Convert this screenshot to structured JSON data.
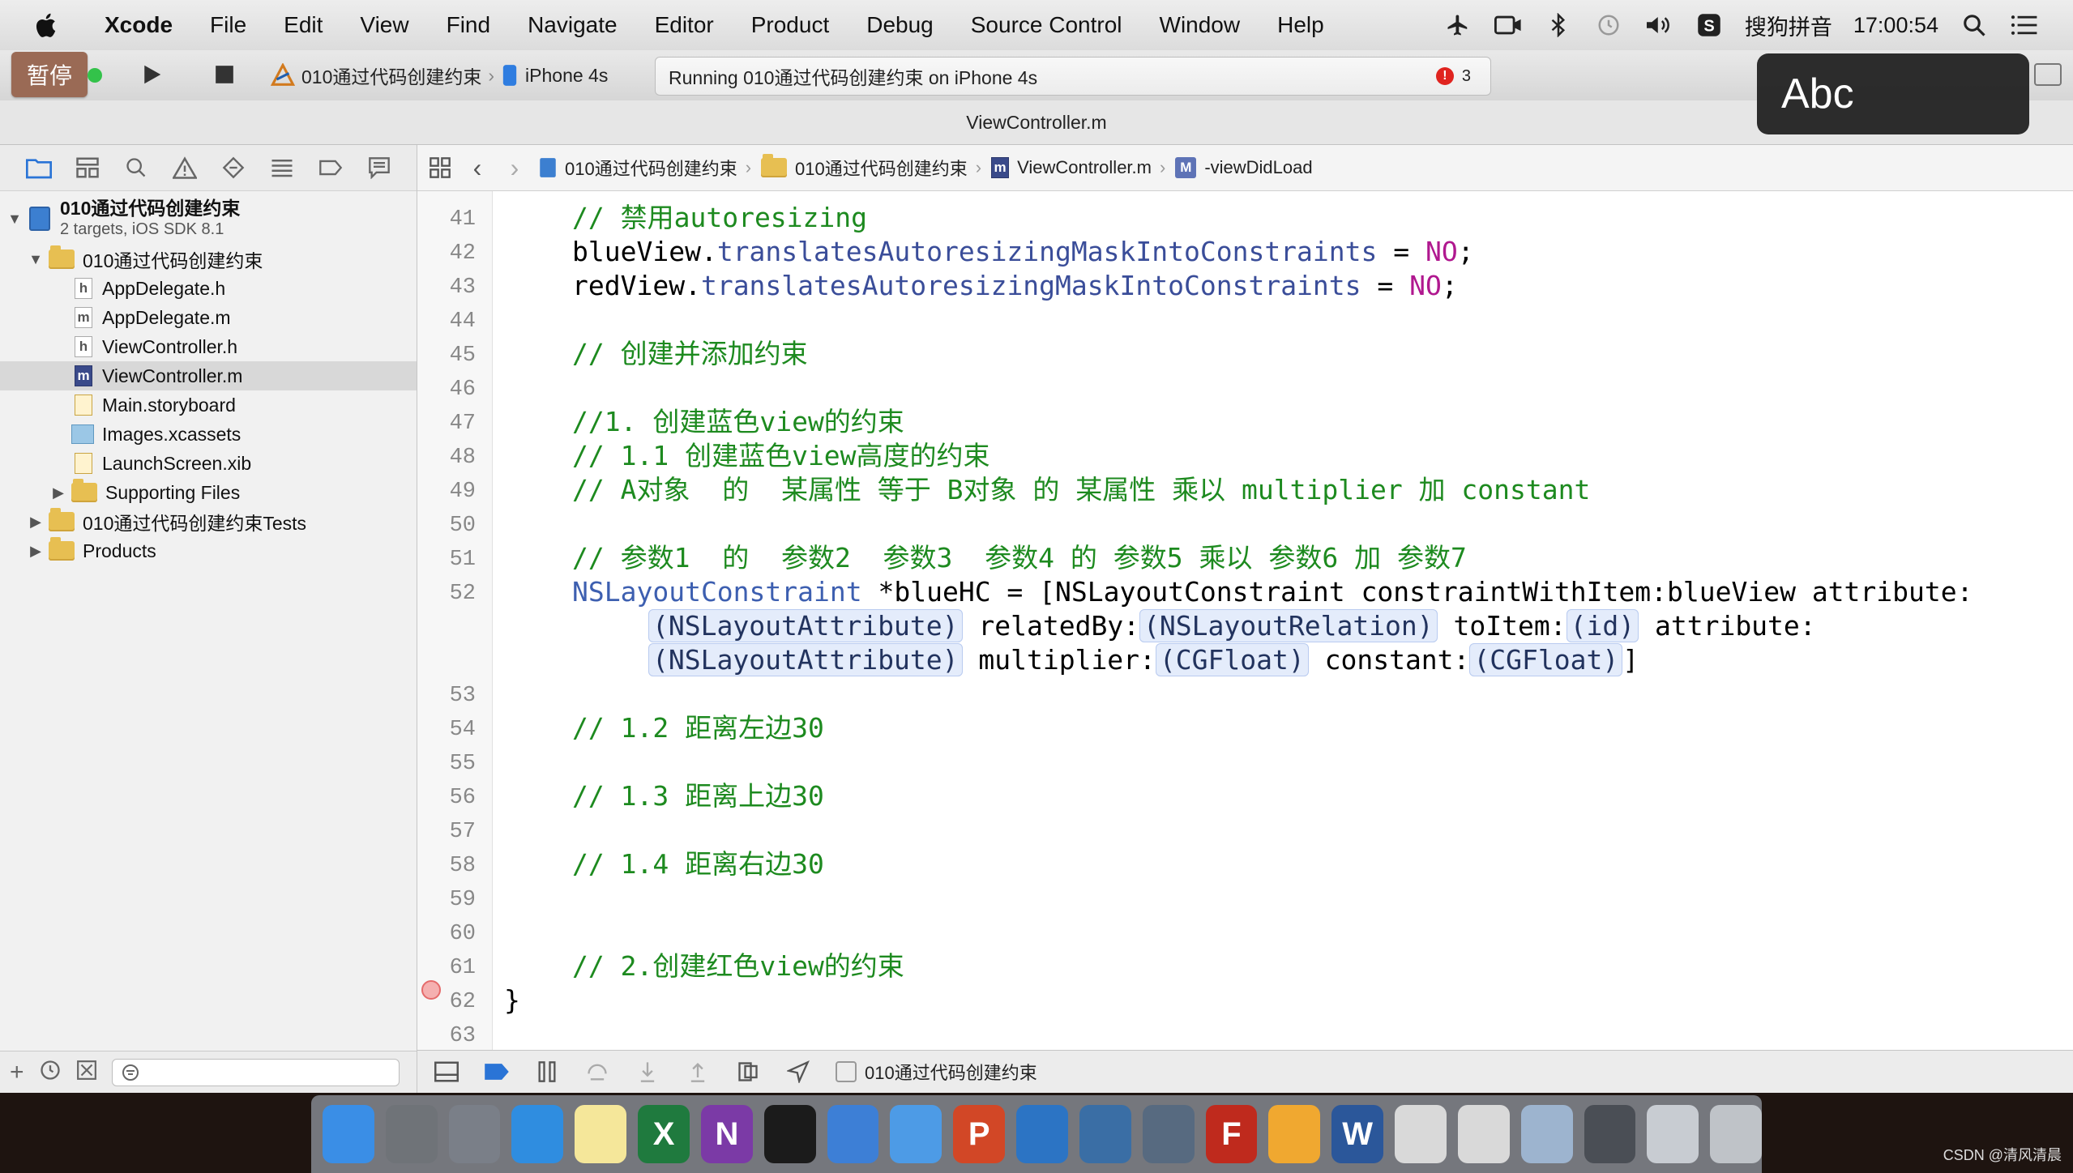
{
  "menubar": {
    "items": [
      "Xcode",
      "File",
      "Edit",
      "View",
      "Find",
      "Navigate",
      "Editor",
      "Product",
      "Debug",
      "Source Control",
      "Window",
      "Help"
    ],
    "input_method": "搜狗拼音",
    "clock": "17:00:54"
  },
  "toolbar": {
    "pause_label": "暂停",
    "scheme_target": "010通过代码创建约束",
    "scheme_device": "iPhone 4s",
    "status_text": "Running 010通过代码创建约束 on iPhone 4s",
    "error_count": "3",
    "input_overlay": "Abc"
  },
  "window": {
    "title": "ViewController.m"
  },
  "navigator": {
    "project_name": "010通过代码创建约束",
    "project_sub": "2 targets, iOS SDK 8.1",
    "group_name": "010通过代码创建约束",
    "files": [
      {
        "letter": "h",
        "name": "AppDelegate.h"
      },
      {
        "letter": "m",
        "name": "AppDelegate.m"
      },
      {
        "letter": "h",
        "name": "ViewController.h"
      },
      {
        "letter": "m",
        "name": "ViewController.m"
      }
    ],
    "storyboard": "Main.storyboard",
    "assets": "Images.xcassets",
    "launch": "LaunchScreen.xib",
    "supporting": "Supporting Files",
    "tests": "010通过代码创建约束Tests",
    "products": "Products"
  },
  "jumpbar": {
    "crumbs": [
      "010通过代码创建约束",
      "010通过代码创建约束",
      "ViewController.m",
      "-viewDidLoad"
    ],
    "method_badge": "M"
  },
  "editor": {
    "line_numbers": [
      "41",
      "42",
      "43",
      "44",
      "45",
      "46",
      "47",
      "48",
      "49",
      "50",
      "51",
      "52",
      "53",
      "54",
      "55",
      "56",
      "57",
      "58",
      "59",
      "60",
      "61",
      "62",
      "63"
    ],
    "lines": {
      "l41": "// 禁用autoresizing",
      "l42a": "blueView.",
      "l42b": "translatesAutoresizingMaskIntoConstraints",
      "l42c": " = ",
      "l42d": "NO",
      "l42e": ";",
      "l43a": "redView.",
      "l43b": "translatesAutoresizingMaskIntoConstraints",
      "l43c": " = ",
      "l43d": "NO",
      "l43e": ";",
      "l45": "// 创建并添加约束",
      "l47": "//1. 创建蓝色view的约束",
      "l48": "// 1.1 创建蓝色view高度的约束",
      "l49": "// A对象  的  某属性 等于 B对象 的 某属性 乘以 multiplier 加 constant",
      "l51": "// 参数1  的  参数2  参数3  参数4 的 参数5 乘以 参数6 加 参数7",
      "l52a": "NSLayoutConstraint",
      "l52b": " *blueHC = [NSLayoutConstraint constraintWithItem:blueView attribute:",
      "l52c_ph1": "(NSLayoutAttribute)",
      "l52c_t1": " relatedBy:",
      "l52c_ph2": "(NSLayoutRelation)",
      "l52c_t2": " toItem:",
      "l52c_ph3": "(id)",
      "l52c_t3": " attribute:",
      "l52d_ph1": "(NSLayoutAttribute)",
      "l52d_t1": " multiplier:",
      "l52d_ph2": "(CGFloat)",
      "l52d_t2": " constant:",
      "l52d_ph3": "(CGFloat)",
      "l52d_t3": "]",
      "l54": "// 1.2 距离左边30",
      "l56": "// 1.3 距离上边30",
      "l58": "// 1.4 距离右边30",
      "l61": "// 2.创建红色view的约束",
      "l62": "}"
    }
  },
  "debugbar": {
    "target": "010通过代码创建约束"
  },
  "dock": {
    "apps": [
      {
        "icon": "finder-icon",
        "color": "#3a8ee6",
        "glyph": ""
      },
      {
        "icon": "system-preferences-icon",
        "color": "#6f7378",
        "glyph": ""
      },
      {
        "icon": "launchpad-icon",
        "color": "#7a7f88",
        "glyph": ""
      },
      {
        "icon": "safari-icon",
        "color": "#2f8de0",
        "glyph": ""
      },
      {
        "icon": "notes-icon",
        "color": "#f5e79a",
        "glyph": ""
      },
      {
        "icon": "excel-icon",
        "color": "#1f7a3e",
        "glyph": "X"
      },
      {
        "icon": "onenote-icon",
        "color": "#7b3aa6",
        "glyph": "N"
      },
      {
        "icon": "terminal-icon",
        "color": "#1b1b1b",
        "glyph": ""
      },
      {
        "icon": "xcode-icon",
        "color": "#3d7fd6",
        "glyph": ""
      },
      {
        "icon": "folder-icon",
        "color": "#4d9be6",
        "glyph": ""
      },
      {
        "icon": "powerpoint-icon",
        "color": "#d24726",
        "glyph": "P"
      },
      {
        "icon": "instruments-icon",
        "color": "#2c74c4",
        "glyph": ""
      },
      {
        "icon": "keynote-icon",
        "color": "#3a6ea5",
        "glyph": ""
      },
      {
        "icon": "simulator-icon",
        "color": "#576a80",
        "glyph": ""
      },
      {
        "icon": "filezilla-icon",
        "color": "#bf2a1d",
        "glyph": "F"
      },
      {
        "icon": "sketch-icon",
        "color": "#f0a830",
        "glyph": ""
      },
      {
        "icon": "word-icon",
        "color": "#2b579a",
        "glyph": "W"
      },
      {
        "icon": "textedit-icon",
        "color": "#d9d9d9",
        "glyph": ""
      },
      {
        "icon": "textedit-icon",
        "color": "#d9d9d9",
        "glyph": ""
      },
      {
        "icon": "preview-icon",
        "color": "#9db4cf",
        "glyph": ""
      },
      {
        "icon": "display-icon",
        "color": "#4a4e55",
        "glyph": ""
      },
      {
        "icon": "keyboard-icon",
        "color": "#c8ccd2",
        "glyph": ""
      },
      {
        "icon": "trash-icon",
        "color": "#bfc3c8",
        "glyph": ""
      }
    ]
  },
  "watermark": "CSDN @清风清晨"
}
